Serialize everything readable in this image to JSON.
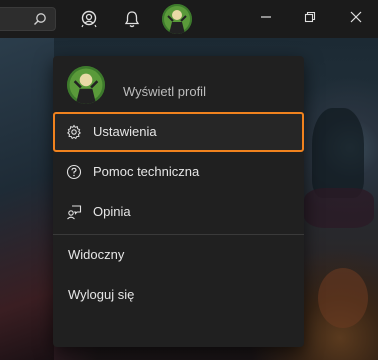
{
  "menu": {
    "profile_label": "Wyświetl profil",
    "items": [
      {
        "label": "Ustawienia",
        "icon": "gear-icon"
      },
      {
        "label": "Pomoc techniczna",
        "icon": "help-circle-icon"
      },
      {
        "label": "Opinia",
        "icon": "feedback-icon"
      }
    ],
    "status_label": "Widoczny",
    "signout_label": "Wyloguj się"
  },
  "colors": {
    "focus_outline": "#f0821e",
    "menu_background": "#202020",
    "titlebar_background": "#1b1b1b"
  }
}
